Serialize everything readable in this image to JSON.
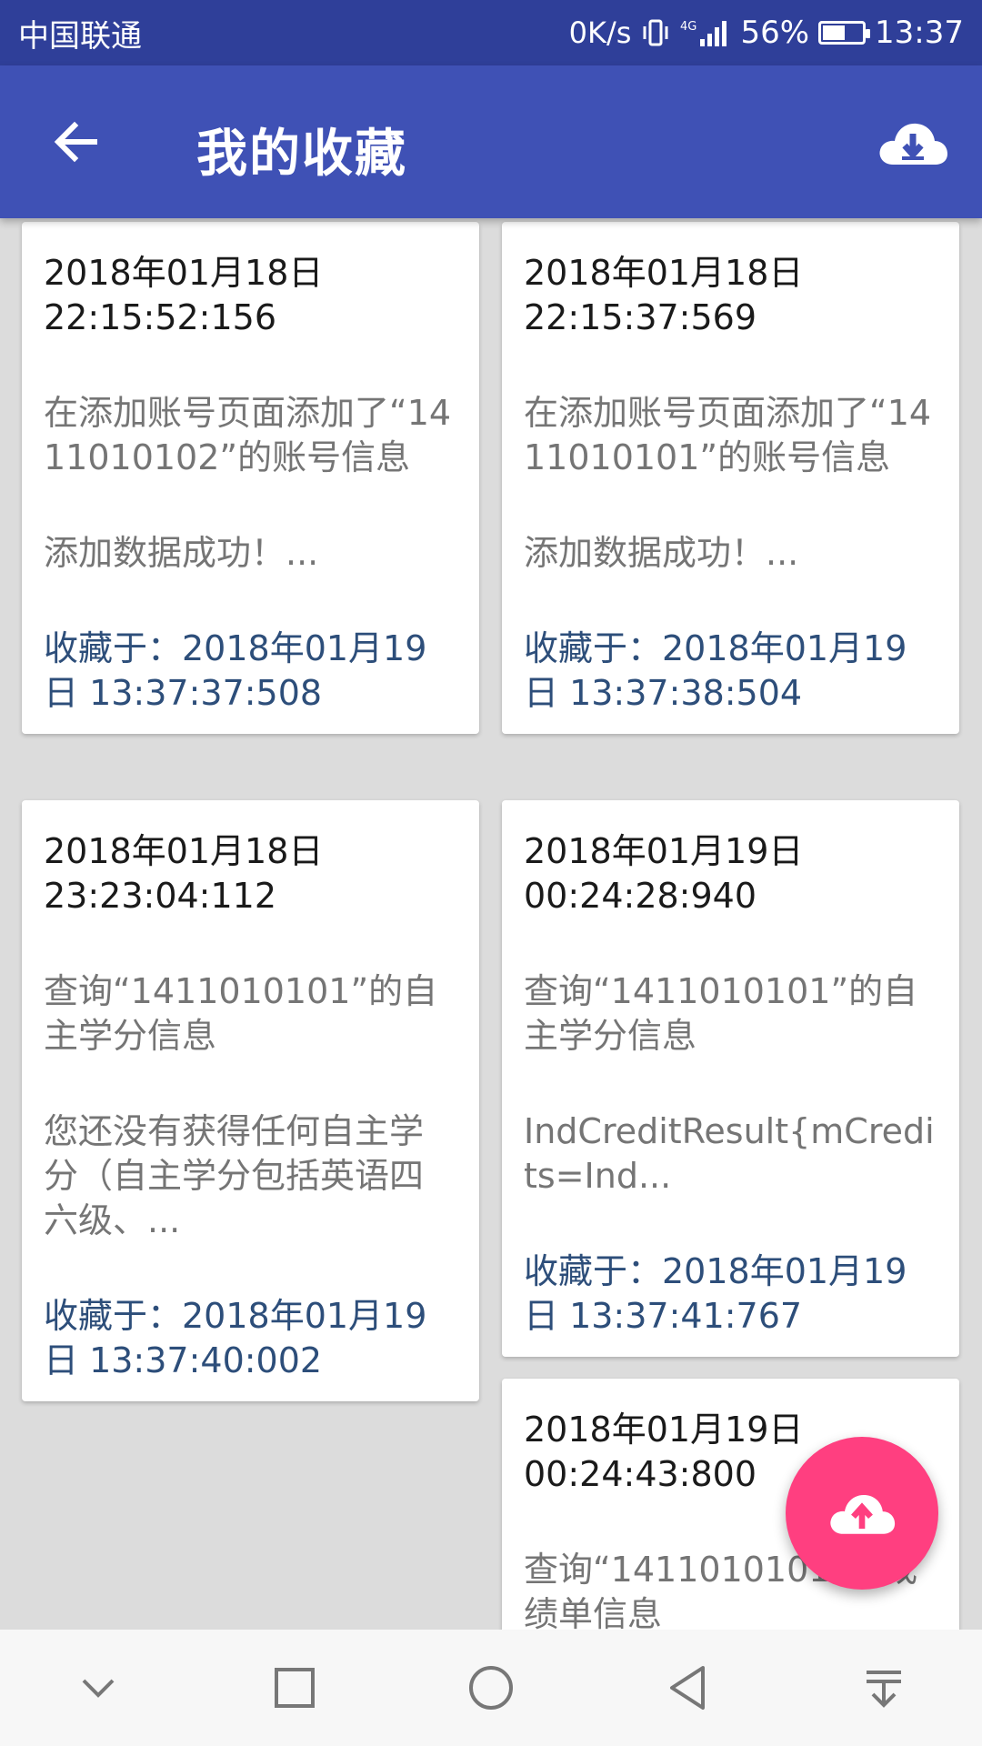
{
  "status_bar": {
    "carrier": "中国联通",
    "net_speed": "0K/s",
    "network_type": "4G",
    "battery_percent": "56%",
    "battery_level": 0.56,
    "time": "13:37"
  },
  "app_bar": {
    "title": "我的收藏",
    "back_icon": "arrow-back-icon",
    "action_icon": "cloud-download-icon"
  },
  "cards": [
    {
      "time": "2018年01月18日\n22:15:52:156",
      "query": "在添加账号页面添加了“1411010102”的账号信息",
      "result": "添加数据成功！...",
      "favorited": "收藏于：2018年01月19日 13:37:37:508"
    },
    {
      "time": "2018年01月18日\n22:15:37:569",
      "query": "在添加账号页面添加了“1411010101”的账号信息",
      "result": "添加数据成功！...",
      "favorited": "收藏于：2018年01月19日 13:37:38:504"
    },
    {
      "time": "2018年01月18日\n23:23:04:112",
      "query": "查询“1411010101”的自主学分信息",
      "result": "您还没有获得任何自主学分（自主学分包括英语四六级、...",
      "favorited": "收藏于：2018年01月19日 13:37:40:002"
    },
    {
      "time": "2018年01月19日\n00:24:28:940",
      "query": "查询“1411010101”的自主学分信息",
      "result": "IndCreditResult{mCredits=Ind...",
      "favorited": "收藏于：2018年01月19日 13:37:41:767"
    },
    {
      "time": "2018年01月19日\n00:24:43:800",
      "query": "查询“1411010101”的成绩单信息",
      "result": "",
      "favorited": ""
    }
  ],
  "fab": {
    "icon": "cloud-upload-icon"
  },
  "nav_bar": {
    "icons": [
      "chevron-down-icon",
      "recents-square-icon",
      "home-circle-icon",
      "back-triangle-icon",
      "notification-pull-icon"
    ]
  },
  "colors": {
    "status_bar": "#2f3f99",
    "app_bar": "#3f51b5",
    "accent": "#ff3f80",
    "favorite_text": "#2d4e7a"
  }
}
